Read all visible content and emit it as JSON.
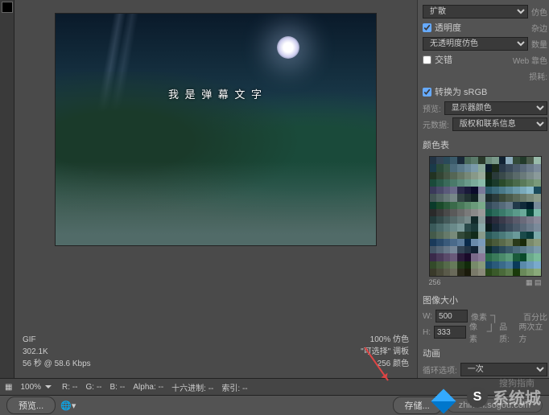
{
  "canvas": {
    "subtitle_text": "我 是 弹 幕 文 字"
  },
  "info": {
    "format": "GIF",
    "size": "302.1K",
    "timing": "56 秒 @ 58.6 Kbps",
    "percent": "100% 仿色",
    "palette": "\"可选择\" 调板",
    "colors": "256 颜色"
  },
  "panel": {
    "dither_select": "扩散",
    "dither_label": "仿色",
    "transparency": "透明度",
    "matte_label": "杂边",
    "matte_select": "无透明度仿色",
    "amount_label": "数量",
    "interlace": "交错",
    "web_snap": "Web 靠色",
    "lossy": "损耗:",
    "convert_srgb": "转换为 sRGB",
    "preview_label": "预览:",
    "preview_select": "显示器颜色",
    "metadata_label": "元数据:",
    "metadata_select": "版权和联系信息",
    "colortable": "颜色表",
    "colortable_count": "256",
    "imagesize": "图像大小",
    "w_label": "W:",
    "w_value": "500",
    "h_label": "H:",
    "h_value": "333",
    "unit": "像素",
    "percent_label": "百分比",
    "quality_label": "品质:",
    "quality_select": "两次立方",
    "anim": "动画",
    "loop": "循环选项:",
    "loop_select": "一次"
  },
  "bottom": {
    "zoom": "100%",
    "r": "R: --",
    "g": "G: --",
    "b": "B: --",
    "alpha": "Alpha: --",
    "hex": "十六进制: --",
    "index": "索引: --"
  },
  "buttons": {
    "preview": "预览...",
    "save": "存储...",
    "url": "zhinan.sogou.com"
  },
  "watermark": {
    "sogou": "搜狗指南",
    "city": "系统城"
  },
  "swatches": [
    "#223344",
    "#334455",
    "#2a4a5a",
    "#3a5a6a",
    "#1a2a3a",
    "#4a6a5a",
    "#5a7a6a",
    "#2a3a2a",
    "#6a8a7a",
    "#7a9a8a",
    "#112233",
    "#8aaabb",
    "#334a3a",
    "#223a2a",
    "#4a5a4a",
    "#99bbaa",
    "#1a3a4a",
    "#2a4a3a",
    "#3a5a4a",
    "#4a6a7a",
    "#5a7a8a",
    "#6a8a9a",
    "#7a9aaa",
    "#8aaa9a",
    "#0a1a2a",
    "#1a2a1a",
    "#2a3a4a",
    "#3a4a5a",
    "#4a5a6a",
    "#5a6a7a",
    "#6a7a8a",
    "#7a8a9a",
    "#223322",
    "#334433",
    "#445544",
    "#556655",
    "#667766",
    "#778877",
    "#889988",
    "#99aa99",
    "#112211",
    "#2a3a3a",
    "#3a4a4a",
    "#4a5a5a",
    "#5a6a6a",
    "#6a7a7a",
    "#7a8a8a",
    "#8a9a9a",
    "#1a4a3a",
    "#2a5a4a",
    "#3a6a5a",
    "#4a7a6a",
    "#5a8a7a",
    "#6a9a8a",
    "#7aaa9a",
    "#8abbaa",
    "#0a2a1a",
    "#1a3a2a",
    "#2a4a2a",
    "#3a5a3a",
    "#4a6a4a",
    "#5a7a5a",
    "#6a8a6a",
    "#7a9a7a",
    "#3a3a5a",
    "#4a4a6a",
    "#5a5a7a",
    "#6a6a8a",
    "#2a2a4a",
    "#1a1a3a",
    "#0a0a2a",
    "#7a7a9a",
    "#2a5a6a",
    "#3a6a7a",
    "#4a7a8a",
    "#5a8a9a",
    "#6a9aaa",
    "#7aaabb",
    "#8abbcc",
    "#1a4a5a",
    "#455",
    "#566",
    "#677",
    "#788",
    "#344",
    "#233",
    "#122",
    "#899",
    "#1a2a2a",
    "#2a3a3a",
    "#3a4a3a",
    "#4a5a4a",
    "#5a6a5a",
    "#6a7a6a",
    "#7a8a7a",
    "#8a9a8a",
    "#0a3a2a",
    "#1a4a2a",
    "#2a5a3a",
    "#3a6a4a",
    "#4a7a5a",
    "#5a8a6a",
    "#6a9a7a",
    "#7aaa8a",
    "#334a5a",
    "#445a6a",
    "#556a7a",
    "#667a8a",
    "#223a4a",
    "#112a3a",
    "#001a2a",
    "#778a9a",
    "#2a2a2a",
    "#3a3a3a",
    "#4a4a4a",
    "#5a5a5a",
    "#6a6a6a",
    "#7a7a7a",
    "#8a8a8a",
    "#9a9a9a",
    "#1a5a4a",
    "#2a6a5a",
    "#3a7a6a",
    "#4a8a7a",
    "#5a9a8a",
    "#6aaa9a",
    "#0a4a3a",
    "#7abbaa",
    "#223a3a",
    "#334a4a",
    "#445a5a",
    "#556a6a",
    "#667a7a",
    "#778a8a",
    "#112a2a",
    "#889a9a",
    "#1a1a2a",
    "#2a2a3a",
    "#3a3a4a",
    "#4a4a5a",
    "#5a5a6a",
    "#6a6a7a",
    "#7a7a8a",
    "#8a8a9a",
    "#3a5a5a",
    "#4a6a6a",
    "#5a7a7a",
    "#6a8a8a",
    "#7a9a9a",
    "#2a4a4a",
    "#1a3a3a",
    "#8aaaaa",
    "#0a1a1a",
    "#1a2a3a",
    "#2a3a4a",
    "#3a4a5a",
    "#4a5a6a",
    "#5a6a7a",
    "#6a7a8a",
    "#7a8a9a",
    "#445a4a",
    "#556a5a",
    "#667a6a",
    "#778a7a",
    "#334a3a",
    "#223a2a",
    "#112a1a",
    "#889a8a",
    "#2a5a5a",
    "#3a6a6a",
    "#4a7a7a",
    "#5a8a8a",
    "#6a9a9a",
    "#1a4a4a",
    "#0a3a3a",
    "#7aaaaa",
    "#1a3a5a",
    "#2a4a6a",
    "#3a5a7a",
    "#4a6a8a",
    "#5a7a9a",
    "#0a2a4a",
    "#6a8aaa",
    "#7a9abb",
    "#3a4a2a",
    "#4a5a3a",
    "#5a6a4a",
    "#6a7a5a",
    "#2a3a1a",
    "#1a2a0a",
    "#7a8a6a",
    "#8a9a7a",
    "#445566",
    "#556677",
    "#667788",
    "#778899",
    "#334455",
    "#223344",
    "#112233",
    "#8899aa",
    "#0a2a2a",
    "#1a3a4a",
    "#2a4a5a",
    "#3a5a6a",
    "#4a6a7a",
    "#5a7a8a",
    "#6a8a9a",
    "#7a9aaa",
    "#3a2a4a",
    "#4a3a5a",
    "#5a4a6a",
    "#6a5a7a",
    "#2a1a3a",
    "#1a0a2a",
    "#7a6a8a",
    "#8a7a9a",
    "#2a6a4a",
    "#3a7a5a",
    "#4a8a6a",
    "#5a9a7a",
    "#1a5a3a",
    "#0a4a2a",
    "#6aaa8a",
    "#7abb9a",
    "#334a2a",
    "#445a3a",
    "#556a4a",
    "#667a5a",
    "#223a1a",
    "#112a0a",
    "#778a6a",
    "#889a7a",
    "#1a4a6a",
    "#2a5a7a",
    "#3a6a8a",
    "#4a7a9a",
    "#0a3a5a",
    "#5a8aaa",
    "#6a9abb",
    "#7aaacc",
    "#3a3a2a",
    "#4a4a3a",
    "#5a5a4a",
    "#6a6a5a",
    "#2a2a1a",
    "#1a1a0a",
    "#7a7a6a",
    "#8a8a7a",
    "#2a4a1a",
    "#3a5a2a",
    "#4a6a3a",
    "#5a7a4a",
    "#1a3a0a",
    "#6a8a5a",
    "#7a9a6a",
    "#8aaa7a"
  ]
}
